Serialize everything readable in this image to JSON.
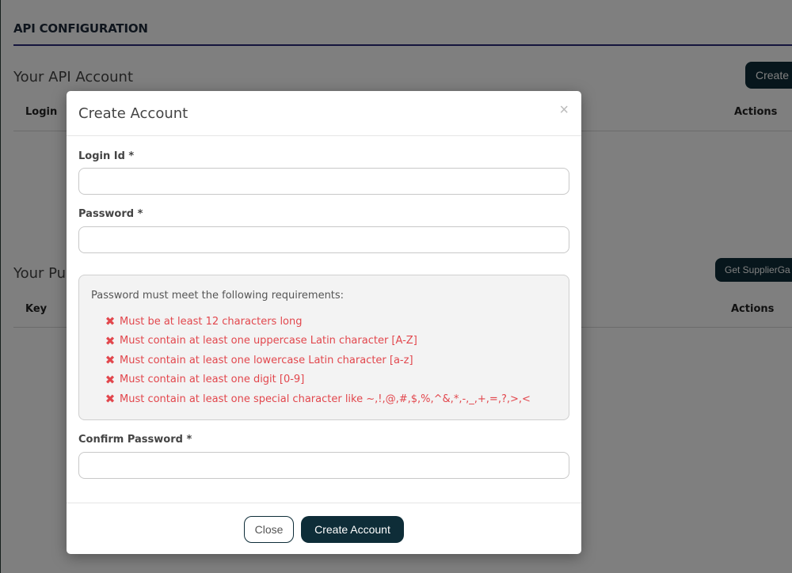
{
  "page": {
    "title": "API CONFIGURATION",
    "account_section": {
      "title": "Your API Account",
      "create_button": "Create",
      "columns": [
        "Login",
        "Actions"
      ]
    },
    "public_key_section": {
      "title": "Your Pu",
      "get_button": "Get SupplierGa",
      "columns": [
        "Key",
        "Actions"
      ]
    }
  },
  "modal": {
    "title": "Create Account",
    "close_symbol": "×",
    "login": {
      "label": "Login Id *",
      "value": "",
      "placeholder": ""
    },
    "password": {
      "label": "Password *",
      "value": "",
      "placeholder": ""
    },
    "requirements": {
      "intro": "Password must meet the following requirements:",
      "status_icon": "x-mark-icon",
      "status_color": "#e2474d",
      "items": [
        "Must be at least 12 characters long",
        "Must contain at least one uppercase Latin character [A-Z]",
        "Must contain at least one lowercase Latin character [a-z]",
        "Must contain at least one digit [0-9]",
        "Must contain at least one special character like ~,!,@,#,$,%,^&,*,-,_,+,=,?,>,<"
      ]
    },
    "confirm": {
      "label": "Confirm Password *",
      "value": "",
      "placeholder": ""
    },
    "footer": {
      "close_label": "Close",
      "create_label": "Create Account"
    }
  },
  "colors": {
    "primary_dark": "#0e2d38",
    "title_rule": "#2b2a7a",
    "error": "#e2474d"
  }
}
